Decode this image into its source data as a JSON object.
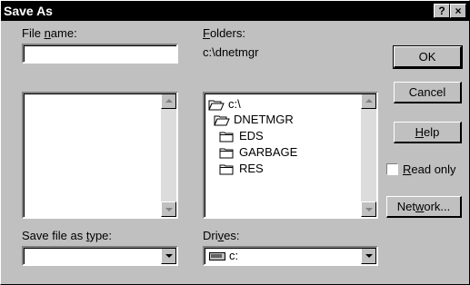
{
  "window": {
    "title": "Save As",
    "help_glyph": "?",
    "close_glyph": "×"
  },
  "file_name": {
    "label_pre": "File ",
    "label_key": "n",
    "label_post": "ame:",
    "value": ""
  },
  "folders": {
    "label_key": "F",
    "label_post": "olders:",
    "current_path": "c:\\dnetmgr",
    "items": [
      {
        "name": "c:\\",
        "icon": "open-folder-icon"
      },
      {
        "name": "DNETMGR",
        "icon": "open-folder-icon"
      },
      {
        "name": "EDS",
        "icon": "folder-icon"
      },
      {
        "name": "GARBAGE",
        "icon": "folder-icon"
      },
      {
        "name": "RES",
        "icon": "folder-icon"
      }
    ]
  },
  "save_type": {
    "label_pre": "Save file as ",
    "label_key": "t",
    "label_post": "ype:",
    "value": ""
  },
  "drives": {
    "label_pre": "Dri",
    "label_key": "v",
    "label_post": "es:",
    "value": "c:"
  },
  "buttons": {
    "ok": "OK",
    "cancel": "Cancel",
    "help_key": "H",
    "help_post": "elp",
    "network_pre": "Net",
    "network_key": "w",
    "network_post": "ork..."
  },
  "read_only": {
    "label_key": "R",
    "label_post": "ead only",
    "checked": false
  }
}
